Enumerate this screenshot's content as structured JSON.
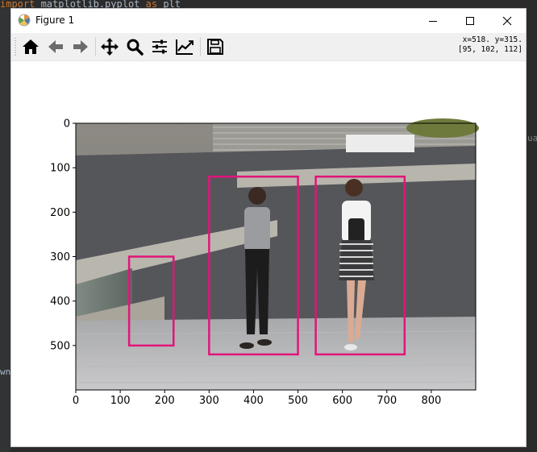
{
  "editor": {
    "code_keyword": "import",
    "code_module": " matplotlib.pyplot ",
    "code_as": "as",
    "code_alias": " plt",
    "right_fragment": "ua",
    "left_fragment": "wn"
  },
  "window": {
    "title": "Figure 1",
    "icons": [
      "matplotlib-logo-icon",
      "minimize-icon",
      "maximize-icon",
      "close-icon"
    ]
  },
  "toolbar": {
    "buttons": [
      {
        "name": "home-button",
        "icon": "home-icon"
      },
      {
        "name": "back-button",
        "icon": "arrow-left-icon"
      },
      {
        "name": "forward-button",
        "icon": "arrow-right-icon"
      },
      {
        "name": "pan-button",
        "icon": "move-arrows-icon"
      },
      {
        "name": "zoom-button",
        "icon": "magnifier-icon"
      },
      {
        "name": "subplots-button",
        "icon": "sliders-icon"
      },
      {
        "name": "edit-axes-button",
        "icon": "chart-line-icon"
      },
      {
        "name": "save-button",
        "icon": "floppy-disk-icon"
      }
    ],
    "coord_line1": "x=518. y=315.",
    "coord_line2": "[95, 102, 112]"
  },
  "chart_data": {
    "type": "image",
    "xlim": [
      0,
      900
    ],
    "ylim": [
      600,
      0
    ],
    "xticks": [
      0,
      100,
      200,
      300,
      400,
      500,
      600,
      700,
      800
    ],
    "yticks": [
      0,
      100,
      200,
      300,
      400,
      500
    ],
    "box_color": "#e0157a",
    "boxes": [
      {
        "x1": 120,
        "y1": 300,
        "x2": 220,
        "y2": 500
      },
      {
        "x1": 300,
        "y1": 120,
        "x2": 500,
        "y2": 520
      },
      {
        "x1": 540,
        "y1": 120,
        "x2": 740,
        "y2": 520
      }
    ]
  }
}
